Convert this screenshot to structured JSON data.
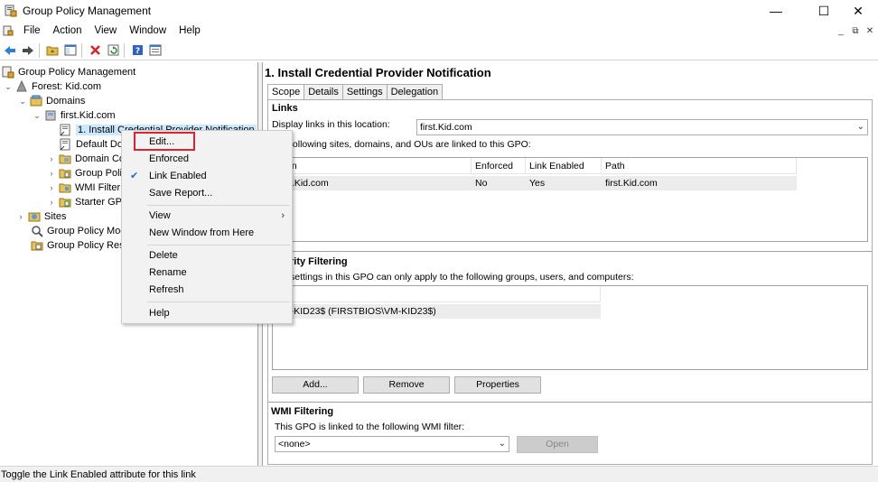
{
  "window": {
    "title": "Group Policy Management"
  },
  "window_controls": {
    "minimize": "—",
    "maximize": "☐",
    "close": "✕"
  },
  "mdi_controls": {
    "minimize": "_",
    "restore": "⧉",
    "close": "✕"
  },
  "menubar": {
    "items": [
      "File",
      "Action",
      "View",
      "Window",
      "Help"
    ]
  },
  "toolbar": {
    "icons": [
      "back-arrow-icon",
      "forward-arrow-icon",
      "folder-up-icon",
      "show-hide-tree-icon",
      "delete-icon",
      "refresh-icon",
      "help-icon",
      "properties-icon"
    ]
  },
  "tree": {
    "root": "Group Policy Management",
    "forest": "Forest: Kid.com",
    "domains": "Domains",
    "domain": "first.Kid.com",
    "gpo_link": "1. Install Credential Provider Notification",
    "default_domain": "Default Do",
    "domain_controllers": "Domain Co",
    "group_policy_objects": "Group Poli",
    "wmi_filters": "WMI Filter",
    "starter_gpos": "Starter GPO",
    "sites": "Sites",
    "modeling": "Group Policy Moc",
    "results": "Group Policy Resu"
  },
  "right": {
    "gpo_title": "1. Install Credential Provider Notification",
    "tabs": [
      "Scope",
      "Details",
      "Settings",
      "Delegation"
    ],
    "links": {
      "title": "Links",
      "display_label": "Display links in this location:",
      "location_value": "first.Kid.com",
      "description": "following sites, domains, and OUs are linked to this GPO:",
      "columns": [
        "ation",
        "Enforced",
        "Link Enabled",
        "Path"
      ],
      "rows": [
        {
          "location": "first.Kid.com",
          "enforced": "No",
          "link_enabled": "Yes",
          "path": "first.Kid.com"
        }
      ]
    },
    "security": {
      "title": "rity Filtering",
      "description": "settings in this GPO can only apply to the following groups, users, and computers:",
      "column": "ne",
      "rows": [
        "VM-KID23$ (FIRSTBIOS\\VM-KID23$)"
      ],
      "buttons": {
        "add": "Add...",
        "remove": "Remove",
        "properties": "Properties"
      }
    },
    "wmi": {
      "title": "WMI Filtering",
      "description": "This GPO is linked to the following WMI filter:",
      "value": "<none>",
      "open_button": "Open"
    }
  },
  "context_menu": {
    "edit": "Edit...",
    "enforced": "Enforced",
    "link_enabled": "Link Enabled",
    "save_report": "Save Report...",
    "view": "View",
    "new_window": "New Window from Here",
    "delete": "Delete",
    "rename": "Rename",
    "refresh": "Refresh",
    "help": "Help"
  },
  "statusbar": {
    "text": "Toggle the Link Enabled attribute for this link"
  }
}
